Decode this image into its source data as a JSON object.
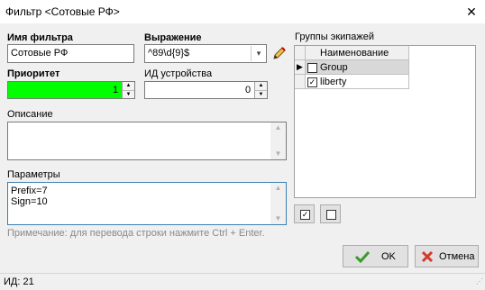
{
  "window": {
    "title": "Фильтр <Сотовые РФ>"
  },
  "fields": {
    "filter_name_label": "Имя фильтра",
    "filter_name_value": "Сотовые РФ",
    "expression_label": "Выражение",
    "expression_value": "^89\\d{9}$",
    "priority_label": "Приоритет",
    "priority_value": "1",
    "device_id_label": "ИД устройства",
    "device_id_value": "0",
    "description_label": "Описание",
    "description_value": "",
    "params_label": "Параметры",
    "params_lines": [
      "Prefix=7",
      "Sign=10"
    ],
    "hint": "Примечание: для перевода строки нажмите Ctrl + Enter."
  },
  "groups": {
    "label": "Группы экипажей",
    "column": "Наименование",
    "rows": [
      {
        "name": "Group",
        "checked": false,
        "current": true
      },
      {
        "name": "liberty",
        "checked": true,
        "current": false
      }
    ]
  },
  "buttons": {
    "ok": "OK",
    "cancel": "Отмена"
  },
  "status": {
    "id_text": "ИД: 21"
  },
  "colors": {
    "priority_bg": "#00ff00",
    "ok_check": "#3a9a2a",
    "cancel_x": "#d23a2a"
  }
}
